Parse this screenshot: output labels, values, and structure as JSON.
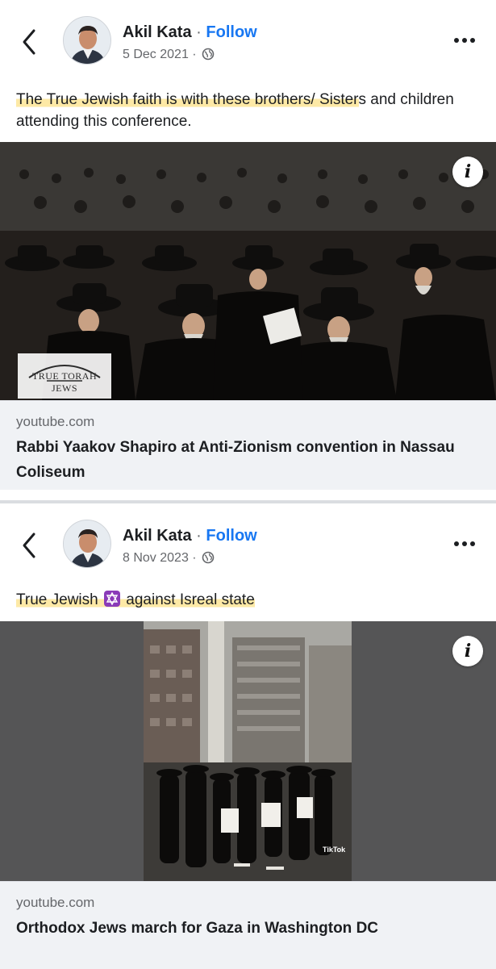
{
  "posts": [
    {
      "author": "Akil Kata",
      "separator": "·",
      "follow_label": "Follow",
      "date": "5 Dec 2021",
      "meta_separator": "·",
      "text_highlighted": "The True Jewish faith is with these brothers/ Sister",
      "text_rest": "s and children attending this conference.",
      "image_watermark": "TRUE TORAH JEWS",
      "info_label": "i",
      "link_domain": "youtube.com",
      "link_title": "Rabbi Yaakov Shapiro at Anti-Zionism convention in Nassau Coliseum"
    },
    {
      "author": "Akil Kata",
      "separator": "·",
      "follow_label": "Follow",
      "date": "8 Nov 2023",
      "meta_separator": "·",
      "text_before": "True Jewish ",
      "text_emoji": "star-of-david-emoji",
      "text_after": "  against Isreal  state",
      "video_overlay": "TikTok",
      "info_label": "i",
      "link_domain": "youtube.com",
      "link_title": "Orthodox Jews march for Gaza in Washington DC"
    }
  ],
  "icons": {
    "back": "chevron-left-icon",
    "more": "more-horizontal-icon",
    "audience": "globe-icon",
    "info": "info-icon"
  },
  "colors": {
    "follow": "#1877f2",
    "secondary_text": "#65676b",
    "highlight": "#fde9a6",
    "link_card_bg": "#f0f2f5"
  }
}
